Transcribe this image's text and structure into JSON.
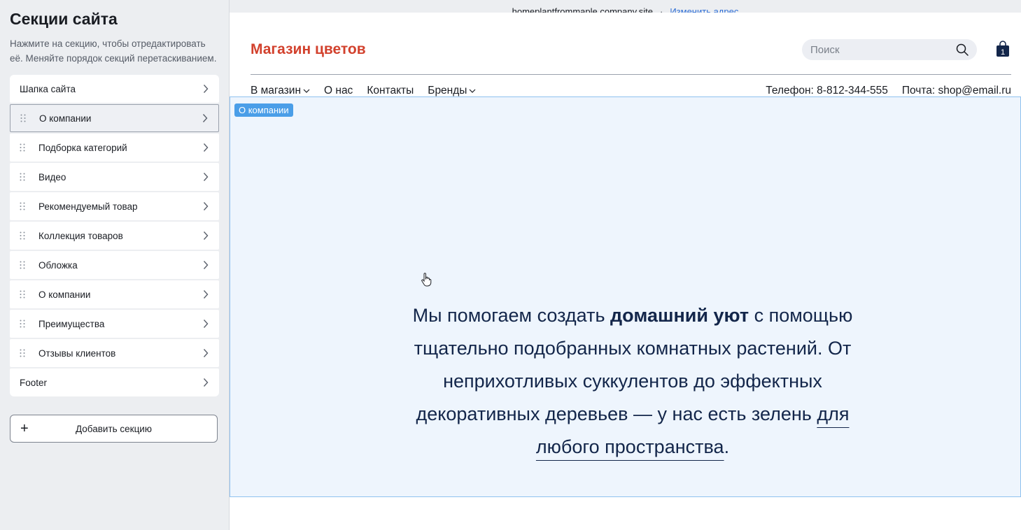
{
  "sidebar": {
    "title": "Секции сайта",
    "hint": "Нажмите на секцию, чтобы отредактировать её. Меняйте порядок секций перетаскиванием.",
    "items": [
      {
        "label": "Шапка сайта",
        "draggable": false
      },
      {
        "label": "О компании",
        "draggable": true,
        "selected": true
      },
      {
        "label": "Подборка категорий",
        "draggable": true
      },
      {
        "label": "Видео",
        "draggable": true
      },
      {
        "label": "Рекомендуемый товар",
        "draggable": true
      },
      {
        "label": "Коллекция товаров",
        "draggable": true
      },
      {
        "label": "Обложка",
        "draggable": true
      },
      {
        "label": "О компании",
        "draggable": true
      },
      {
        "label": "Преимущества",
        "draggable": true
      },
      {
        "label": "Отзывы клиентов",
        "draggable": true
      },
      {
        "label": "Footer",
        "draggable": false
      }
    ],
    "add_button": "Добавить секцию"
  },
  "topbar": {
    "domain": "homeplantfrommaple.company.site",
    "separator": "·",
    "change_link": "Изменить адрес"
  },
  "site": {
    "logo": "Магазин цветов",
    "search_placeholder": "Поиск",
    "cart_count": "1",
    "nav": {
      "shop": "В магазин",
      "about": "О нас",
      "contacts": "Контакты",
      "brands": "Бренды"
    },
    "phone": "Телефон: 8-812-344-555",
    "email": "Почта: shop@email.ru"
  },
  "about": {
    "tag": "О компании",
    "text_pre": "Мы помогаем создать ",
    "text_bold": "домашний уют",
    "text_mid": " с помощью тщательно подобранных комнатных растений. От неприхотливых суккулентов до эффектных декоративных деревьев — у нас есть зелень ",
    "text_underlined": "для любого пространства",
    "text_end": "."
  },
  "colors": {
    "logo": "#d2412d",
    "accent_link": "#2f6fd6",
    "section_highlight_bg": "#eef5fd",
    "section_highlight_border": "#8fc1ef",
    "tag_bg": "#4a9ee8",
    "body_text": "#13264a"
  }
}
